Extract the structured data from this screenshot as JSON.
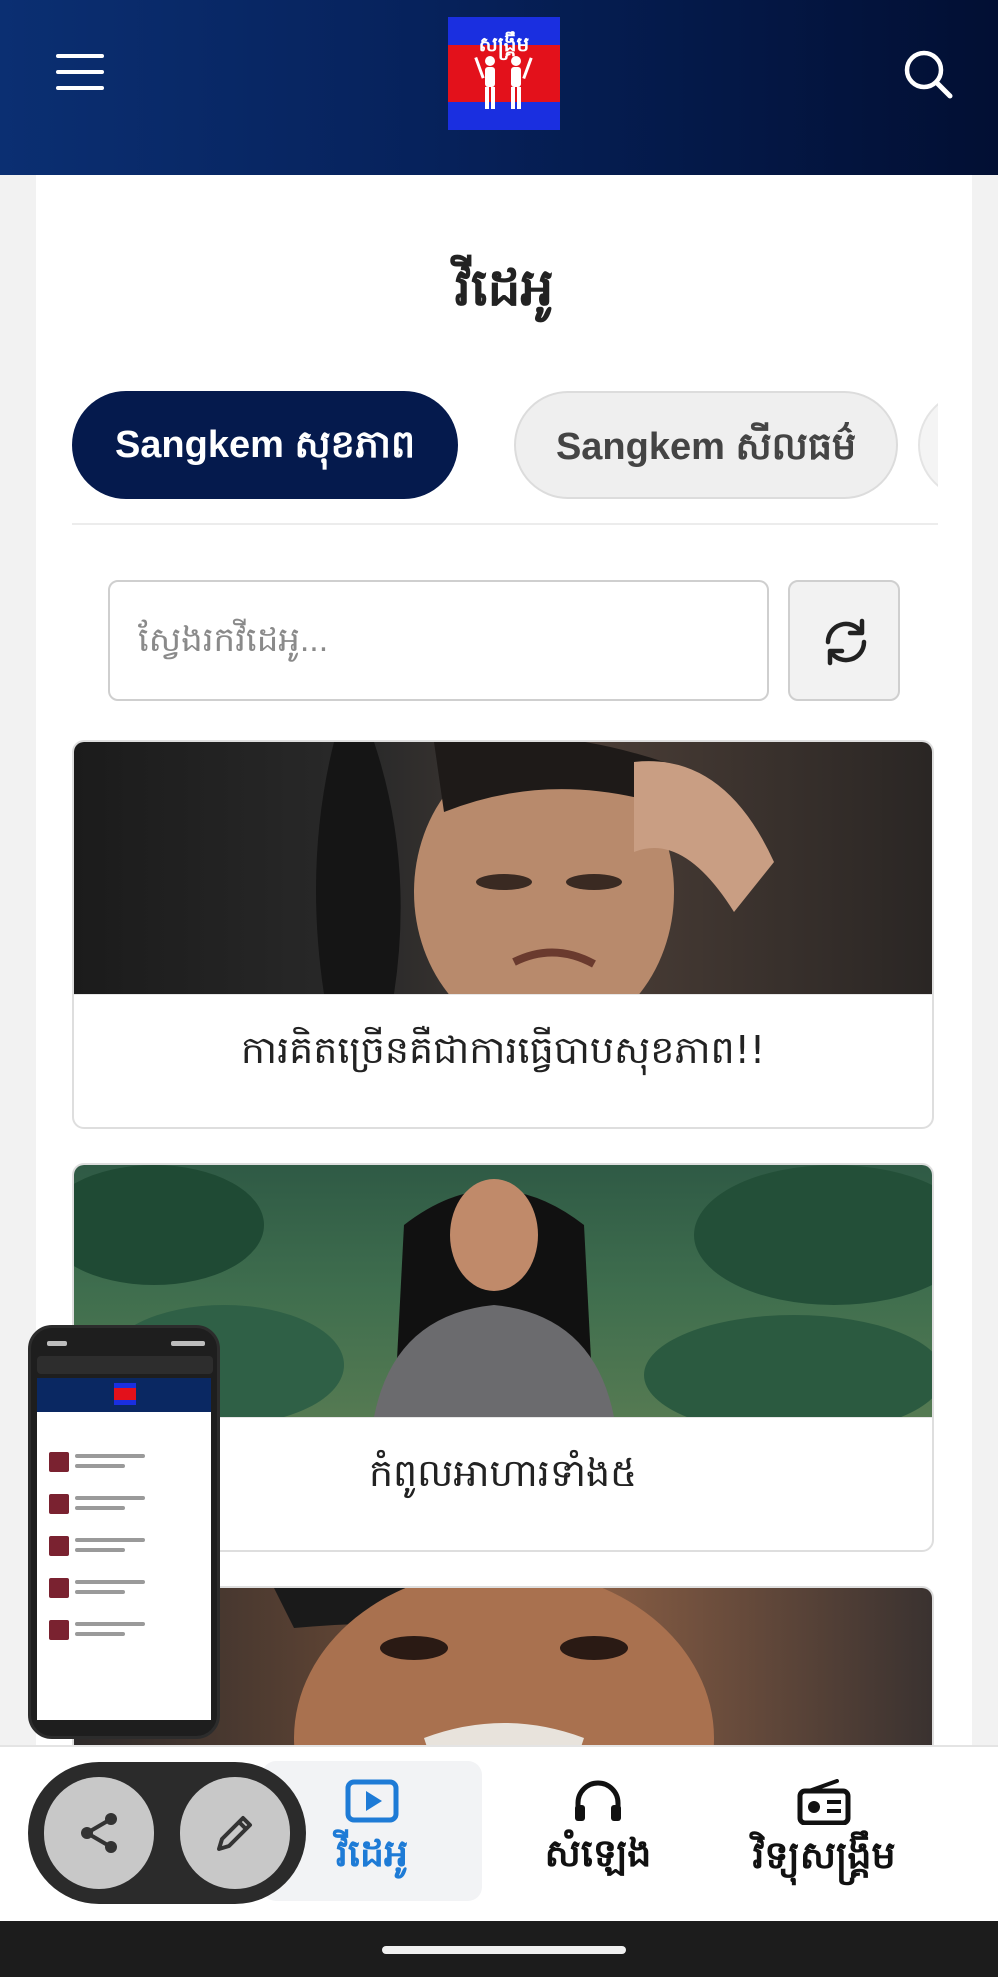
{
  "header": {
    "logo_text": "សង្គ្រឹម",
    "menu_icon": "hamburger-menu-icon",
    "search_icon": "search-icon"
  },
  "page": {
    "title": "វីដេអូ"
  },
  "tabs": [
    {
      "label": "Sangkem សុខភាព",
      "active": true
    },
    {
      "label": "Sangkem សីលធម៌",
      "active": false
    }
  ],
  "search": {
    "placeholder": "ស្វែងរកវីដេអូ...",
    "refresh_icon": "refresh-icon"
  },
  "videos": [
    {
      "title": "ការគិតច្រើនគឺជាការធ្វើបាបសុខភាព!!"
    },
    {
      "title": "កំពូលអាហារទាំង៥"
    },
    {
      "title": ""
    }
  ],
  "bottom_nav": [
    {
      "label": "វីដេអូ",
      "icon": "video-play-icon",
      "active": true
    },
    {
      "label": "សំឡេង",
      "icon": "headphones-icon",
      "active": false
    },
    {
      "label": "វិទ្យុសង្គ្រឹម",
      "icon": "radio-icon",
      "active": false
    }
  ],
  "floating": {
    "share_icon": "share-icon",
    "edit_icon": "pencil-icon"
  },
  "colors": {
    "header_start": "#0b2f72",
    "header_end": "#020f33",
    "tab_active": "#051a4d",
    "nav_active": "#1e7bd6"
  }
}
